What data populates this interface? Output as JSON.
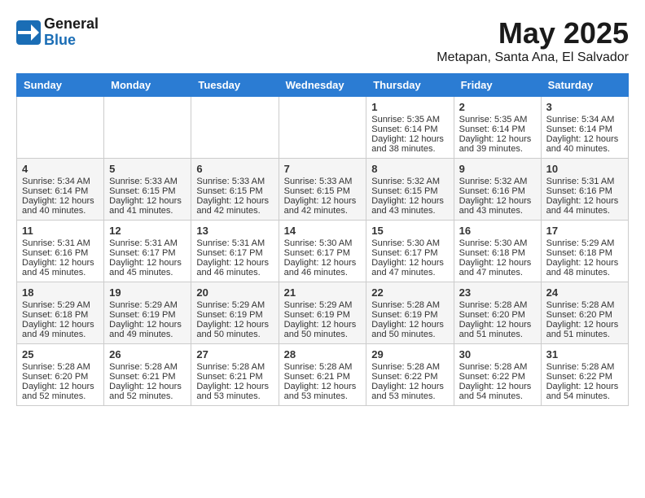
{
  "header": {
    "logo_general": "General",
    "logo_blue": "Blue",
    "month_title": "May 2025",
    "location": "Metapan, Santa Ana, El Salvador"
  },
  "weekdays": [
    "Sunday",
    "Monday",
    "Tuesday",
    "Wednesday",
    "Thursday",
    "Friday",
    "Saturday"
  ],
  "weeks": [
    [
      {
        "day": "",
        "content": ""
      },
      {
        "day": "",
        "content": ""
      },
      {
        "day": "",
        "content": ""
      },
      {
        "day": "",
        "content": ""
      },
      {
        "day": "1",
        "content": "Sunrise: 5:35 AM\nSunset: 6:14 PM\nDaylight: 12 hours\nand 38 minutes."
      },
      {
        "day": "2",
        "content": "Sunrise: 5:35 AM\nSunset: 6:14 PM\nDaylight: 12 hours\nand 39 minutes."
      },
      {
        "day": "3",
        "content": "Sunrise: 5:34 AM\nSunset: 6:14 PM\nDaylight: 12 hours\nand 40 minutes."
      }
    ],
    [
      {
        "day": "4",
        "content": "Sunrise: 5:34 AM\nSunset: 6:14 PM\nDaylight: 12 hours\nand 40 minutes."
      },
      {
        "day": "5",
        "content": "Sunrise: 5:33 AM\nSunset: 6:15 PM\nDaylight: 12 hours\nand 41 minutes."
      },
      {
        "day": "6",
        "content": "Sunrise: 5:33 AM\nSunset: 6:15 PM\nDaylight: 12 hours\nand 42 minutes."
      },
      {
        "day": "7",
        "content": "Sunrise: 5:33 AM\nSunset: 6:15 PM\nDaylight: 12 hours\nand 42 minutes."
      },
      {
        "day": "8",
        "content": "Sunrise: 5:32 AM\nSunset: 6:15 PM\nDaylight: 12 hours\nand 43 minutes."
      },
      {
        "day": "9",
        "content": "Sunrise: 5:32 AM\nSunset: 6:16 PM\nDaylight: 12 hours\nand 43 minutes."
      },
      {
        "day": "10",
        "content": "Sunrise: 5:31 AM\nSunset: 6:16 PM\nDaylight: 12 hours\nand 44 minutes."
      }
    ],
    [
      {
        "day": "11",
        "content": "Sunrise: 5:31 AM\nSunset: 6:16 PM\nDaylight: 12 hours\nand 45 minutes."
      },
      {
        "day": "12",
        "content": "Sunrise: 5:31 AM\nSunset: 6:17 PM\nDaylight: 12 hours\nand 45 minutes."
      },
      {
        "day": "13",
        "content": "Sunrise: 5:31 AM\nSunset: 6:17 PM\nDaylight: 12 hours\nand 46 minutes."
      },
      {
        "day": "14",
        "content": "Sunrise: 5:30 AM\nSunset: 6:17 PM\nDaylight: 12 hours\nand 46 minutes."
      },
      {
        "day": "15",
        "content": "Sunrise: 5:30 AM\nSunset: 6:17 PM\nDaylight: 12 hours\nand 47 minutes."
      },
      {
        "day": "16",
        "content": "Sunrise: 5:30 AM\nSunset: 6:18 PM\nDaylight: 12 hours\nand 47 minutes."
      },
      {
        "day": "17",
        "content": "Sunrise: 5:29 AM\nSunset: 6:18 PM\nDaylight: 12 hours\nand 48 minutes."
      }
    ],
    [
      {
        "day": "18",
        "content": "Sunrise: 5:29 AM\nSunset: 6:18 PM\nDaylight: 12 hours\nand 49 minutes."
      },
      {
        "day": "19",
        "content": "Sunrise: 5:29 AM\nSunset: 6:19 PM\nDaylight: 12 hours\nand 49 minutes."
      },
      {
        "day": "20",
        "content": "Sunrise: 5:29 AM\nSunset: 6:19 PM\nDaylight: 12 hours\nand 50 minutes."
      },
      {
        "day": "21",
        "content": "Sunrise: 5:29 AM\nSunset: 6:19 PM\nDaylight: 12 hours\nand 50 minutes."
      },
      {
        "day": "22",
        "content": "Sunrise: 5:28 AM\nSunset: 6:19 PM\nDaylight: 12 hours\nand 50 minutes."
      },
      {
        "day": "23",
        "content": "Sunrise: 5:28 AM\nSunset: 6:20 PM\nDaylight: 12 hours\nand 51 minutes."
      },
      {
        "day": "24",
        "content": "Sunrise: 5:28 AM\nSunset: 6:20 PM\nDaylight: 12 hours\nand 51 minutes."
      }
    ],
    [
      {
        "day": "25",
        "content": "Sunrise: 5:28 AM\nSunset: 6:20 PM\nDaylight: 12 hours\nand 52 minutes."
      },
      {
        "day": "26",
        "content": "Sunrise: 5:28 AM\nSunset: 6:21 PM\nDaylight: 12 hours\nand 52 minutes."
      },
      {
        "day": "27",
        "content": "Sunrise: 5:28 AM\nSunset: 6:21 PM\nDaylight: 12 hours\nand 53 minutes."
      },
      {
        "day": "28",
        "content": "Sunrise: 5:28 AM\nSunset: 6:21 PM\nDaylight: 12 hours\nand 53 minutes."
      },
      {
        "day": "29",
        "content": "Sunrise: 5:28 AM\nSunset: 6:22 PM\nDaylight: 12 hours\nand 53 minutes."
      },
      {
        "day": "30",
        "content": "Sunrise: 5:28 AM\nSunset: 6:22 PM\nDaylight: 12 hours\nand 54 minutes."
      },
      {
        "day": "31",
        "content": "Sunrise: 5:28 AM\nSunset: 6:22 PM\nDaylight: 12 hours\nand 54 minutes."
      }
    ]
  ]
}
